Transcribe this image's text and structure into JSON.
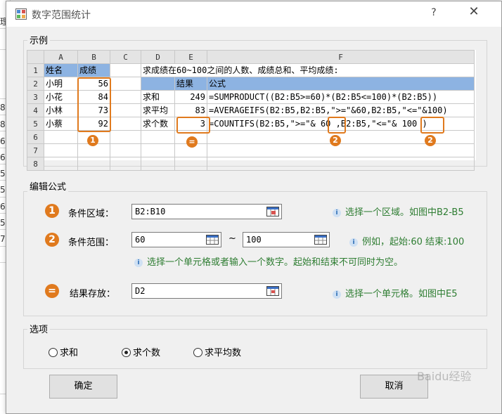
{
  "window": {
    "title": "数字范围统计",
    "help": "?",
    "close": "✕"
  },
  "background": {
    "row_numbers": [
      "8",
      "8",
      "6",
      "6",
      "5",
      "5",
      "6",
      "5",
      "7"
    ],
    "corner": "理"
  },
  "example": {
    "legend": "示例",
    "columns": [
      "A",
      "B",
      "C",
      "D",
      "E",
      "F"
    ],
    "rows": [
      "1",
      "2",
      "3",
      "4",
      "5",
      "6",
      "7",
      "8"
    ],
    "r1": {
      "a": "姓名",
      "b": "成绩",
      "d": "求成绩在60~100之间的人数、成绩总和、平均成绩:"
    },
    "r2": {
      "a": "小明",
      "b": "56",
      "e": "结果",
      "f": "公式"
    },
    "r3": {
      "a": "小花",
      "b": "84",
      "d": "求和",
      "e": "249",
      "f": "=SUMPRODUCT((B2:B5>=60)*(B2:B5<=100)*(B2:B5))"
    },
    "r4": {
      "a": "小林",
      "b": "73",
      "d": "求平均",
      "e": "83",
      "f": "=AVERAGEIFS(B2:B5,B2:B5,\">=\"&60,B2:B5,\"<=\"&100)"
    },
    "r5": {
      "a": "小蔡",
      "b": "92",
      "d": "求个数",
      "e": "3",
      "f1": "=COUNTIFS(B2:B5,\">=\"& ",
      "f2": "60",
      "f3": " ,B2:B5,\"<=\"& ",
      "f4": "100",
      "f5": " )"
    },
    "badges": [
      "1",
      "=",
      "2",
      "2"
    ]
  },
  "edit": {
    "legend": "编辑公式",
    "cond_area": {
      "badge": "1",
      "label": "条件区域：",
      "value": "B2:B10",
      "hint": "选择一个区域。如图中B2-B5"
    },
    "cond_range": {
      "badge": "2",
      "label": "条件范围：",
      "start": "60",
      "tilde": "~",
      "end": "100",
      "hint": "例如，起始:60 结束:100"
    },
    "range_hint": "选择一个单元格或者输入一个数字。起始和结束不可同时为空。",
    "result": {
      "badge": "=",
      "label": "结果存放：",
      "value": "D2",
      "hint": "选择一个单元格。如图中E5"
    }
  },
  "options": {
    "legend": "选项",
    "items": [
      {
        "label": "求和",
        "selected": false
      },
      {
        "label": "求个数",
        "selected": true
      },
      {
        "label": "求平均数",
        "selected": false
      }
    ]
  },
  "buttons": {
    "ok": "确定",
    "cancel": "取消"
  },
  "watermark": "Baidu经验",
  "colors": {
    "accent": "#e07a1e",
    "header_blue": "#8db3e2",
    "hint_green": "#2e7d32"
  }
}
